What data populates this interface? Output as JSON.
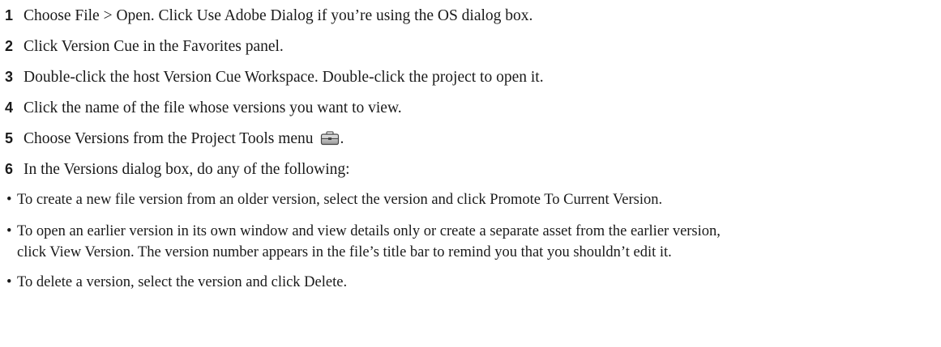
{
  "steps": [
    {
      "num": "1",
      "text": "Choose File > Open. Click Use Adobe Dialog if you’re using the OS dialog box."
    },
    {
      "num": "2",
      "text": "Click Version Cue in the Favorites panel."
    },
    {
      "num": "3",
      "text": "Double-click the host Version Cue Workspace. Double-click the project to open it."
    },
    {
      "num": "4",
      "text": "Click the name of the file whose versions you want to view."
    },
    {
      "num": "5",
      "text": "Choose Versions from the Project Tools menu",
      "text_after_icon": ".",
      "icon": "project-tools-icon"
    },
    {
      "num": "6",
      "text": "In the Versions dialog box, do any of the following:"
    }
  ],
  "bullets": [
    {
      "marker": "•",
      "text": "To create a new file version from an older version, select the version and click Promote To Current Version."
    },
    {
      "marker": "•",
      "line1": "To open an earlier version in its own window and view details only or create a separate asset from the earlier version,",
      "line2": "click View Version. The version number appears in the file’s title bar to remind you that you shouldn’t edit it."
    },
    {
      "marker": "•",
      "text": "To delete a version, select the version and click Delete."
    }
  ]
}
